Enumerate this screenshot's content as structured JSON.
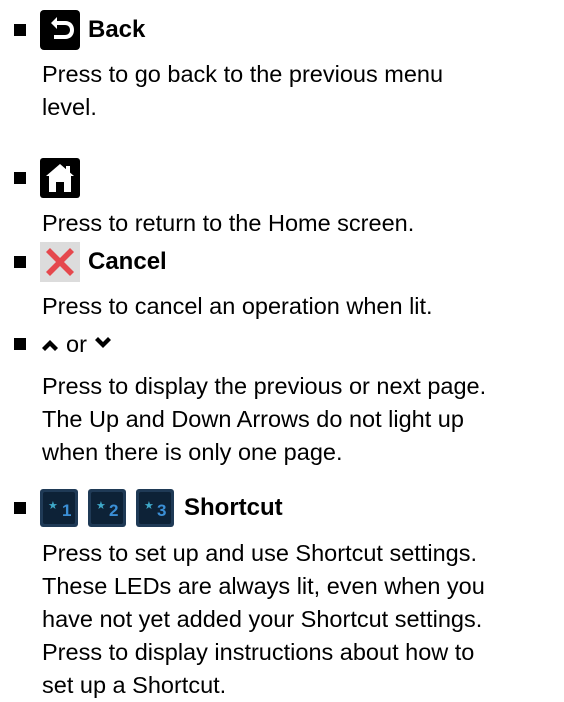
{
  "items": [
    {
      "title": "Back",
      "icon": "back-arrow-icon",
      "lines": [
        "Press to go back to the previous menu",
        "level."
      ]
    },
    {
      "title": "",
      "icon": "home-icon",
      "lines": [
        "Press to return to the Home screen."
      ]
    },
    {
      "title": "Cancel",
      "icon": "cancel-x-icon",
      "lines": [
        "Press to cancel an operation when lit."
      ]
    },
    {
      "title": "",
      "icon": "up-down-arrow-icons",
      "or_text": "or",
      "lines": [
        "Press to display the previous or next page.",
        "The Up and Down Arrows do not light up",
        "when there is only one page."
      ]
    },
    {
      "title": "Shortcut",
      "icon": "shortcut-buttons-icon",
      "shortcut_labels": [
        "1",
        "2",
        "3"
      ],
      "lines": [
        "Press to set up and use Shortcut settings.",
        "These LEDs are always lit, even when you",
        "have not yet added your Shortcut settings.",
        "Press  to display instructions about how to",
        "set up a Shortcut."
      ]
    }
  ],
  "colors": {
    "cancel_red": "#e5484d",
    "shortcut_blue": "#3b8fd6",
    "shortcut_teal": "#3fa9c9",
    "icon_dark": "#000000"
  }
}
